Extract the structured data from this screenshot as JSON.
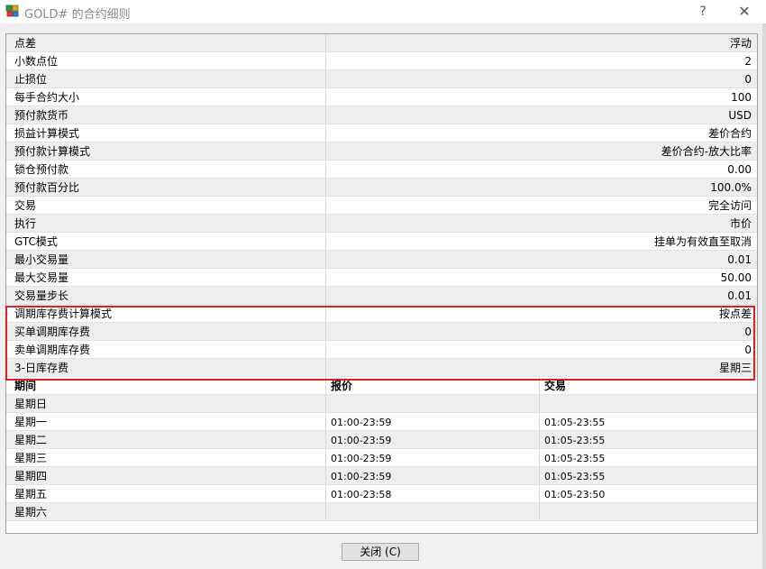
{
  "window": {
    "title": "GOLD# 的合约细则",
    "help_label": "?",
    "close_label": "✕"
  },
  "properties": [
    {
      "name": "点差",
      "value": "浮动"
    },
    {
      "name": "小数点位",
      "value": "2"
    },
    {
      "name": "止损位",
      "value": "0"
    },
    {
      "name": "每手合约大小",
      "value": "100"
    },
    {
      "name": "预付款货币",
      "value": "USD"
    },
    {
      "name": "损益计算模式",
      "value": "差价合约"
    },
    {
      "name": "预付款计算模式",
      "value": "差价合约-放大比率"
    },
    {
      "name": "锁仓预付款",
      "value": "0.00"
    },
    {
      "name": "预付款百分比",
      "value": "100.0%"
    },
    {
      "name": "交易",
      "value": "完全访问"
    },
    {
      "name": "执行",
      "value": "市价"
    },
    {
      "name": "GTC模式",
      "value": "挂单为有效直至取消"
    },
    {
      "name": "最小交易量",
      "value": "0.01"
    },
    {
      "name": "最大交易量",
      "value": "50.00"
    },
    {
      "name": "交易量步长",
      "value": "0.01"
    },
    {
      "name": "调期库存费计算模式",
      "value": "按点差"
    },
    {
      "name": "买单调期库存费",
      "value": "0"
    },
    {
      "name": "卖单调期库存费",
      "value": "0"
    },
    {
      "name": "3-日库存费",
      "value": "星期三"
    }
  ],
  "schedule": {
    "headers": [
      "期间",
      "报价",
      "交易"
    ],
    "rows": [
      {
        "day": "星期日",
        "quote": "",
        "trade": ""
      },
      {
        "day": "星期一",
        "quote": "01:00-23:59",
        "trade": "01:05-23:55"
      },
      {
        "day": "星期二",
        "quote": "01:00-23:59",
        "trade": "01:05-23:55"
      },
      {
        "day": "星期三",
        "quote": "01:00-23:59",
        "trade": "01:05-23:55"
      },
      {
        "day": "星期四",
        "quote": "01:00-23:59",
        "trade": "01:05-23:55"
      },
      {
        "day": "星期五",
        "quote": "01:00-23:58",
        "trade": "01:05-23:50"
      },
      {
        "day": "星期六",
        "quote": "",
        "trade": ""
      }
    ]
  },
  "footer": {
    "close_button_label": "关闭 (C)"
  },
  "colors": {
    "highlight": "#e02020",
    "alt_row": "#eeeeee"
  },
  "icons": {
    "app": "gold-bars-icon",
    "help": "question-icon",
    "close": "close-icon"
  }
}
